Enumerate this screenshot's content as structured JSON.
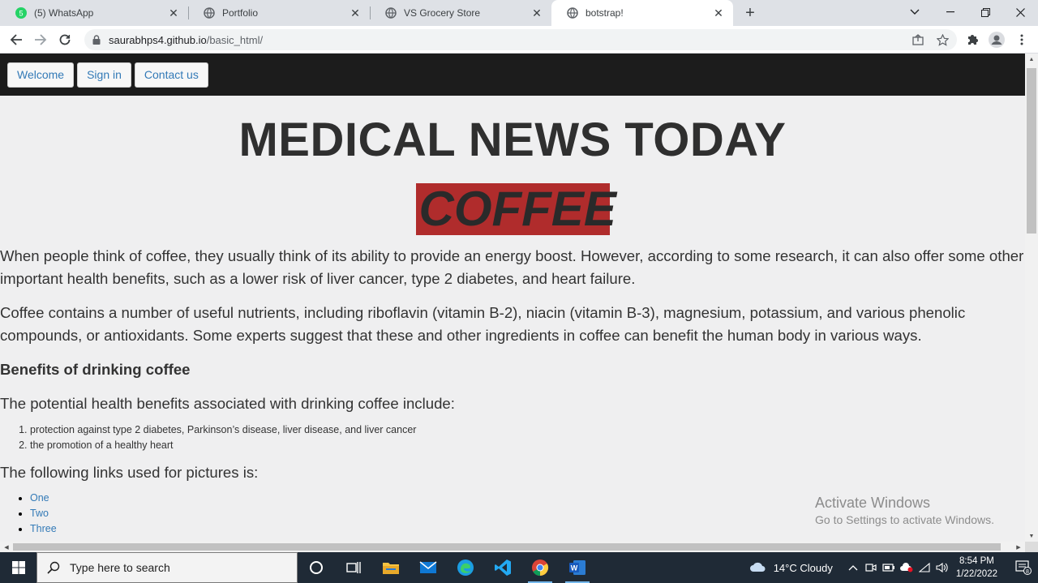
{
  "browser": {
    "tabs": [
      {
        "title": "(5) WhatsApp",
        "badge": "5",
        "active": false
      },
      {
        "title": "Portfolio",
        "active": false
      },
      {
        "title": "VS Grocery Store",
        "active": false
      },
      {
        "title": "botstrap!",
        "active": true
      }
    ],
    "url_host": "saurabhps4.github.io",
    "url_path": "/basic_html/"
  },
  "page": {
    "nav": [
      "Welcome",
      "Sign in",
      "Contact us"
    ],
    "headline": "MEDICAL NEWS TODAY",
    "banner": "COFFEE",
    "paragraph1": "When people think of coffee, they usually think of its ability to provide an energy boost. However, according to some research, it can also offer some other important health benefits, such as a lower risk of liver cancer, type 2 diabetes, and heart failure.",
    "paragraph2": "Coffee contains a number of useful nutrients, including riboflavin (vitamin B-2), niacin (vitamin B-3), magnesium, potassium, and various phenolic compounds, or antioxidants. Some experts suggest that these and other ingredients in coffee can benefit the human body in various ways.",
    "subheading": "Benefits of drinking coffee",
    "intro": "The potential health benefits associated with drinking coffee include:",
    "benefits": [
      "protection against type 2 diabetes, Parkinson’s disease, liver disease, and liver cancer",
      "the promotion of a healthy heart"
    ],
    "links_heading": "The following links used for pictures is:",
    "links": [
      "One",
      "Two",
      "Three"
    ]
  },
  "watermark": {
    "line1": "Activate Windows",
    "line2": "Go to Settings to activate Windows."
  },
  "taskbar": {
    "search_placeholder": "Type here to search",
    "weather": "14°C  Cloudy",
    "time": "8:54 PM",
    "date": "1/22/2022",
    "notification_count": "8"
  },
  "colors": {
    "navbar": "#1c1c1c",
    "banner": "#b02c2c",
    "link": "#337ab7",
    "page_bg": "#efeff0"
  }
}
